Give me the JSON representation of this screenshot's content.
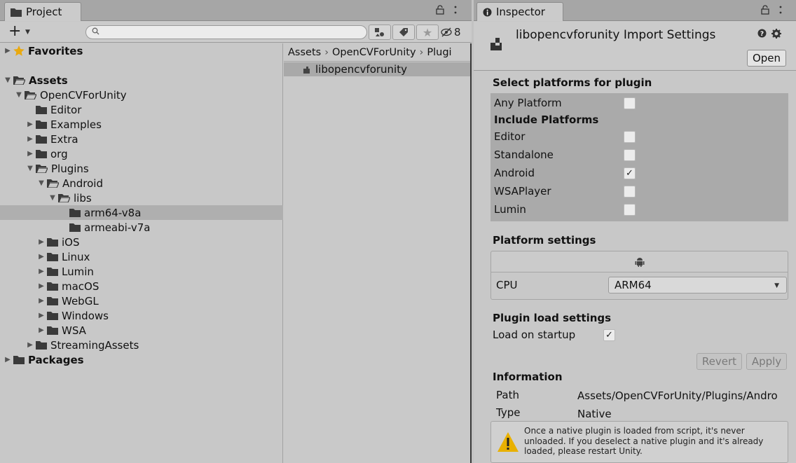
{
  "project": {
    "tab_label": "Project",
    "lock_icon": "lock-icon",
    "more_icon": "kebab-menu-icon",
    "hidden_packages_count": "8",
    "tree": [
      {
        "label": "Favorites",
        "depth": 0,
        "arrow": "right",
        "icon": "star",
        "bold": true
      },
      {
        "label": "",
        "depth": 0,
        "arrow": "none",
        "icon": "none",
        "bold": false
      },
      {
        "label": "Assets",
        "depth": 0,
        "arrow": "down",
        "icon": "folder-open",
        "bold": true
      },
      {
        "label": "OpenCVForUnity",
        "depth": 1,
        "arrow": "down",
        "icon": "folder-open",
        "bold": false
      },
      {
        "label": "Editor",
        "depth": 2,
        "arrow": "none",
        "icon": "folder",
        "bold": false
      },
      {
        "label": "Examples",
        "depth": 2,
        "arrow": "right",
        "icon": "folder",
        "bold": false
      },
      {
        "label": "Extra",
        "depth": 2,
        "arrow": "right",
        "icon": "folder",
        "bold": false
      },
      {
        "label": "org",
        "depth": 2,
        "arrow": "right",
        "icon": "folder",
        "bold": false
      },
      {
        "label": "Plugins",
        "depth": 2,
        "arrow": "down",
        "icon": "folder-open",
        "bold": false
      },
      {
        "label": "Android",
        "depth": 3,
        "arrow": "down",
        "icon": "folder-open",
        "bold": false
      },
      {
        "label": "libs",
        "depth": 4,
        "arrow": "down",
        "icon": "folder-open",
        "bold": false
      },
      {
        "label": "arm64-v8a",
        "depth": 5,
        "arrow": "none",
        "icon": "folder",
        "bold": false,
        "selected": true
      },
      {
        "label": "armeabi-v7a",
        "depth": 5,
        "arrow": "none",
        "icon": "folder",
        "bold": false
      },
      {
        "label": "iOS",
        "depth": 3,
        "arrow": "right",
        "icon": "folder",
        "bold": false
      },
      {
        "label": "Linux",
        "depth": 3,
        "arrow": "right",
        "icon": "folder",
        "bold": false
      },
      {
        "label": "Lumin",
        "depth": 3,
        "arrow": "right",
        "icon": "folder",
        "bold": false
      },
      {
        "label": "macOS",
        "depth": 3,
        "arrow": "right",
        "icon": "folder",
        "bold": false
      },
      {
        "label": "WebGL",
        "depth": 3,
        "arrow": "right",
        "icon": "folder",
        "bold": false
      },
      {
        "label": "Windows",
        "depth": 3,
        "arrow": "right",
        "icon": "folder",
        "bold": false
      },
      {
        "label": "WSA",
        "depth": 3,
        "arrow": "right",
        "icon": "folder",
        "bold": false
      },
      {
        "label": "StreamingAssets",
        "depth": 2,
        "arrow": "right",
        "icon": "folder",
        "bold": false
      },
      {
        "label": "Packages",
        "depth": 0,
        "arrow": "right",
        "icon": "folder",
        "bold": true
      }
    ],
    "breadcrumb": [
      "Assets",
      "OpenCVForUnity",
      "Plugi"
    ],
    "asset_item": "libopencvforunity"
  },
  "inspector": {
    "tab_label": "Inspector",
    "title": "libopencvforunity Import Settings",
    "open_button": "Open",
    "select_platforms_title": "Select platforms for plugin",
    "any_platform": {
      "label": "Any Platform",
      "checked": false
    },
    "include_platforms_title": "Include Platforms",
    "platforms": [
      {
        "label": "Editor",
        "checked": false
      },
      {
        "label": "Standalone",
        "checked": false
      },
      {
        "label": "Android",
        "checked": true
      },
      {
        "label": "WSAPlayer",
        "checked": false
      },
      {
        "label": "Lumin",
        "checked": false
      }
    ],
    "platform_settings_title": "Platform settings",
    "cpu_label": "CPU",
    "cpu_value": "ARM64",
    "plugin_load_title": "Plugin load settings",
    "load_on_startup": {
      "label": "Load on startup",
      "checked": true
    },
    "revert_button": "Revert",
    "apply_button": "Apply",
    "information_title": "Information",
    "path_label": "Path",
    "path_value": "Assets/OpenCVForUnity/Plugins/Andro",
    "type_label": "Type",
    "type_value": "Native",
    "warning_text": "Once a native plugin is loaded from script, it's never unloaded. If you deselect a native plugin and it's already loaded, please restart Unity."
  },
  "colors": {
    "selected_row": "#afafaf",
    "panel_bg": "#c8c8c8",
    "warning_yellow": "#e8b000"
  }
}
